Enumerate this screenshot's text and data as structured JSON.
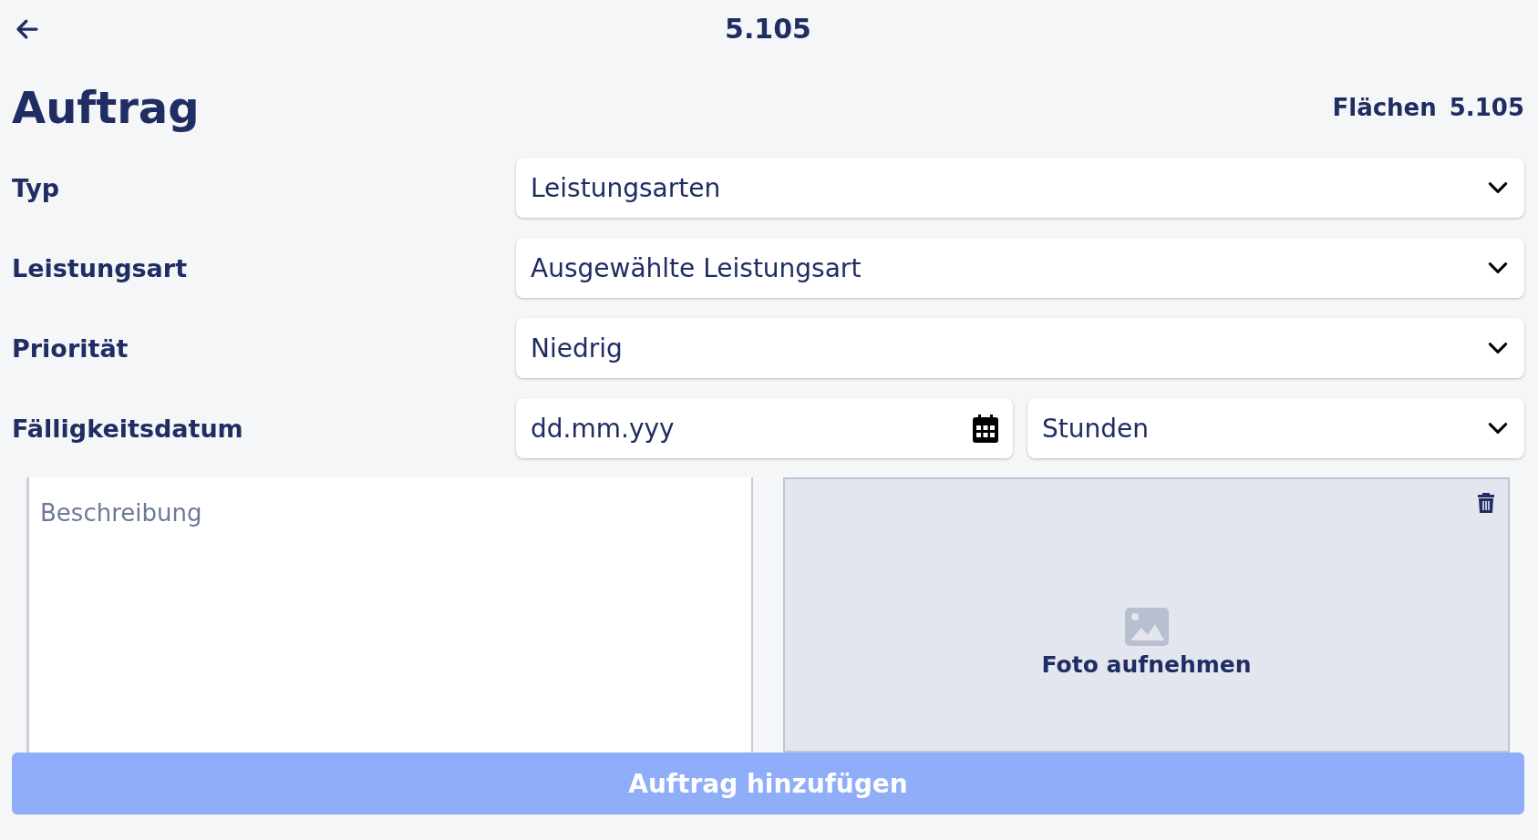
{
  "header": {
    "title": "5.105"
  },
  "heading": "Auftrag",
  "area": {
    "label": "Flächen",
    "value": "5.105"
  },
  "fields": [
    {
      "label": "Typ",
      "controls": [
        {
          "kind": "select",
          "value": "Leistungsarten"
        }
      ]
    },
    {
      "label": "Leistungsart",
      "controls": [
        {
          "kind": "select",
          "value": "Ausgewählte Leistungsart"
        }
      ]
    },
    {
      "label": "Priorität",
      "controls": [
        {
          "kind": "select",
          "value": "Niedrig"
        }
      ]
    },
    {
      "label": "Fälligkeitsdatum",
      "controls": [
        {
          "kind": "date",
          "value": "dd.mm.yyy"
        },
        {
          "kind": "select",
          "value": "Stunden"
        }
      ]
    }
  ],
  "description": {
    "placeholder": "Beschreibung"
  },
  "photo": {
    "label": "Foto aufnehmen"
  },
  "submit_button": "Auftrag hinzufügen"
}
